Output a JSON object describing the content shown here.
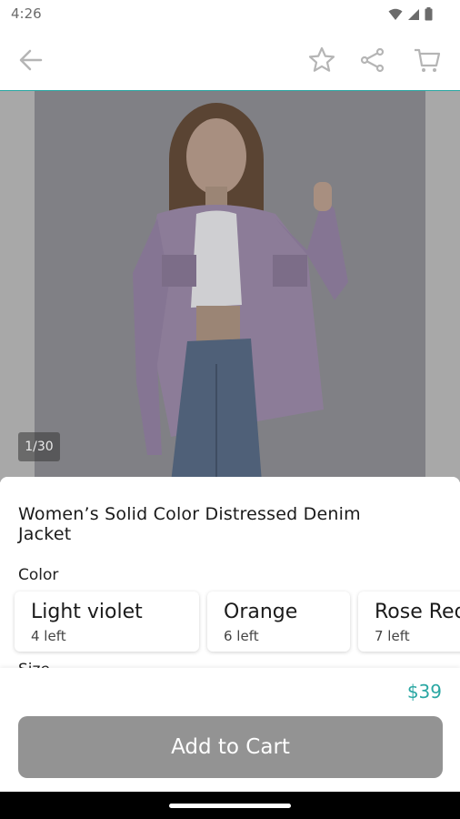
{
  "status_bar": {
    "time": "4:26",
    "icons": [
      "wifi-icon",
      "cell-signal-icon",
      "battery-icon"
    ]
  },
  "top_bar": {
    "icons": [
      "arrow-left-icon",
      "star-icon",
      "share-icon",
      "cart-icon"
    ],
    "accent_color": "#2aa7a3"
  },
  "image": {
    "counter": "1/30"
  },
  "product": {
    "title": "Women’s Solid Color Distressed Denim Jacket",
    "color_label": "Color",
    "size_label": "Size",
    "colors": [
      {
        "name": "Light violet",
        "stock": "4 left"
      },
      {
        "name": "Orange",
        "stock": "6 left"
      },
      {
        "name": "Rose Red",
        "stock": "7 left"
      }
    ],
    "price": "$39",
    "price_color": "#2aa7a3"
  },
  "actions": {
    "add_to_cart": "Add to Cart"
  }
}
